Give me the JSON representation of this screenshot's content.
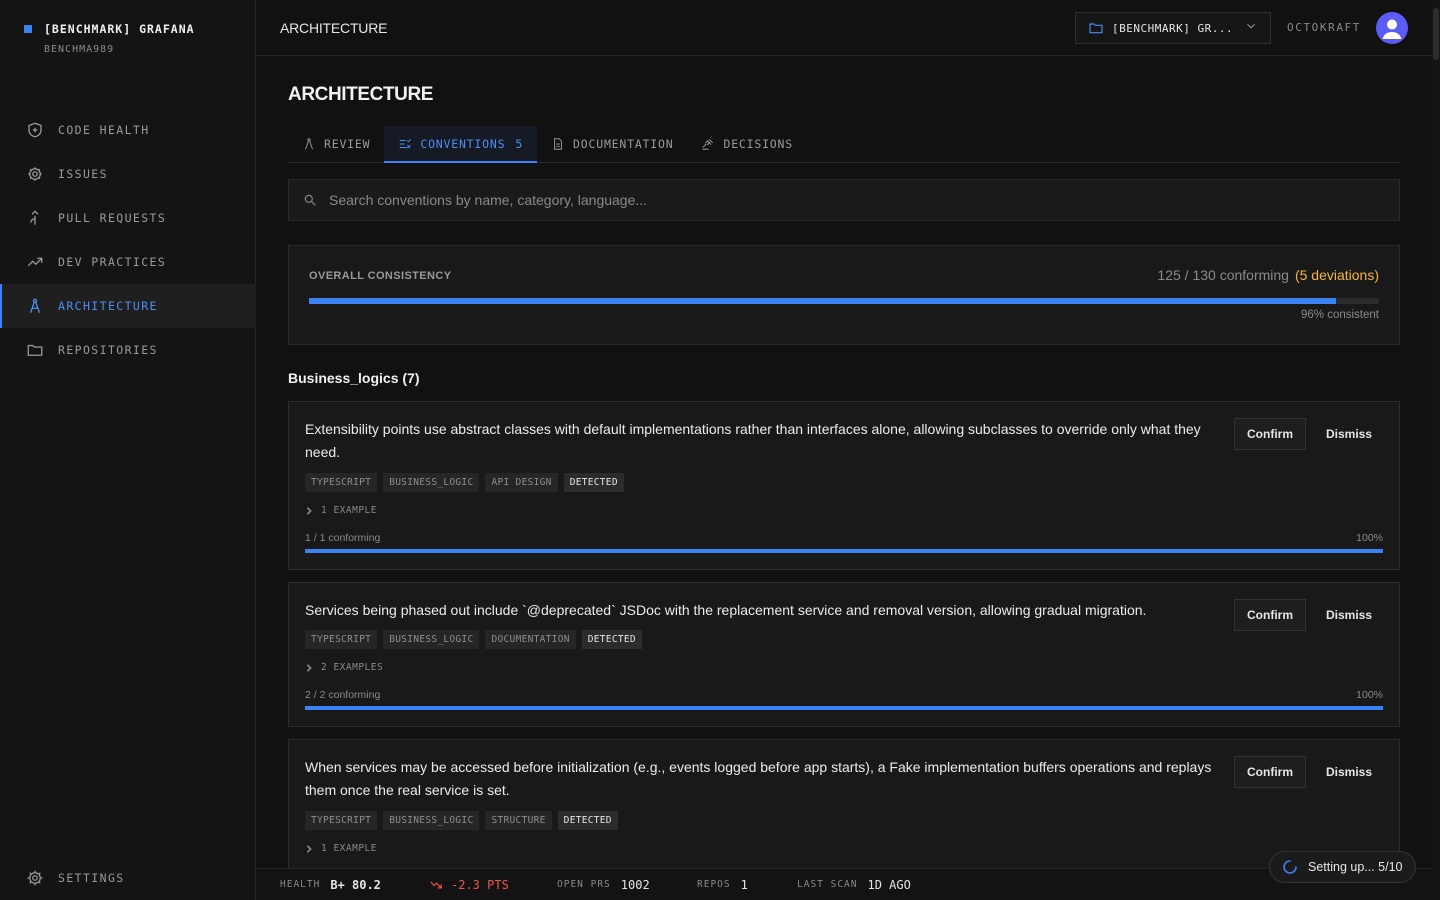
{
  "brand": {
    "title": "[BENCHMARK] GRAFANA",
    "subtitle": "BENCHMA989"
  },
  "sidebar": {
    "items": [
      {
        "label": "CODE HEALTH",
        "icon": "shield-icon"
      },
      {
        "label": "ISSUES",
        "icon": "bug-icon"
      },
      {
        "label": "PULL REQUESTS",
        "icon": "merge-icon"
      },
      {
        "label": "DEV PRACTICES",
        "icon": "trend-icon"
      },
      {
        "label": "ARCHITECTURE",
        "icon": "compass-icon",
        "active": true
      },
      {
        "label": "REPOSITORIES",
        "icon": "folder-icon"
      }
    ],
    "settings_label": "SETTINGS"
  },
  "topbar": {
    "title": "ARCHITECTURE",
    "repo_label": "[BENCHMARK] GR...",
    "org": "OCTOKRAFT"
  },
  "page": {
    "title": "ARCHITECTURE"
  },
  "tabs": [
    {
      "label": "REVIEW",
      "icon": "compass-icon"
    },
    {
      "label": "CONVENTIONS",
      "count": "5",
      "icon": "list-check-icon",
      "active": true
    },
    {
      "label": "DOCUMENTATION",
      "icon": "document-icon"
    },
    {
      "label": "DECISIONS",
      "icon": "gavel-icon"
    }
  ],
  "search": {
    "placeholder": "Search conventions by name, category, language..."
  },
  "overall": {
    "label": "OVERALL CONSISTENCY",
    "stats": "125 / 130 conforming",
    "deviations": "(5 deviations)",
    "progress": 0.96,
    "percent_text": "96% consistent"
  },
  "section": {
    "title": "Business_logics (7)"
  },
  "buttons": {
    "confirm": "Confirm",
    "dismiss": "Dismiss"
  },
  "cards": [
    {
      "text": "Extensibility points use abstract classes with default implementations rather than interfaces alone, allowing subclasses to override only what they need.",
      "tags": [
        "TYPESCRIPT",
        "BUSINESS_LOGIC",
        "API DESIGN"
      ],
      "status": "DETECTED",
      "examples": "1 EXAMPLE",
      "conforming": "1 / 1 conforming",
      "percent": "100%",
      "progress": 1.0
    },
    {
      "text": "Services being phased out include `@deprecated` JSDoc with the replacement service and removal version, allowing gradual migration.",
      "tags": [
        "TYPESCRIPT",
        "BUSINESS_LOGIC",
        "DOCUMENTATION"
      ],
      "status": "DETECTED",
      "examples": "2 EXAMPLES",
      "conforming": "2 / 2 conforming",
      "percent": "100%",
      "progress": 1.0
    },
    {
      "text": "When services may be accessed before initialization (e.g., events logged before app starts), a Fake implementation buffers operations and replays them once the real service is set.",
      "tags": [
        "TYPESCRIPT",
        "BUSINESS_LOGIC",
        "STRUCTURE"
      ],
      "status": "DETECTED",
      "examples": "1 EXAMPLE"
    }
  ],
  "footer": {
    "health_label": "HEALTH",
    "health_value": "B+ 80.2",
    "delta": "-2.3 PTS",
    "open_prs_label": "OPEN PRS",
    "open_prs_value": "1002",
    "repos_label": "REPOS",
    "repos_value": "1",
    "last_scan_label": "LAST SCAN",
    "last_scan_value": "1D AGO"
  },
  "toast": {
    "text": "Setting up... 5/10"
  },
  "colors": {
    "accent": "#3b82f6",
    "warning": "#f5b73b",
    "danger": "#f05252",
    "avatar": "#5b5bf5"
  }
}
